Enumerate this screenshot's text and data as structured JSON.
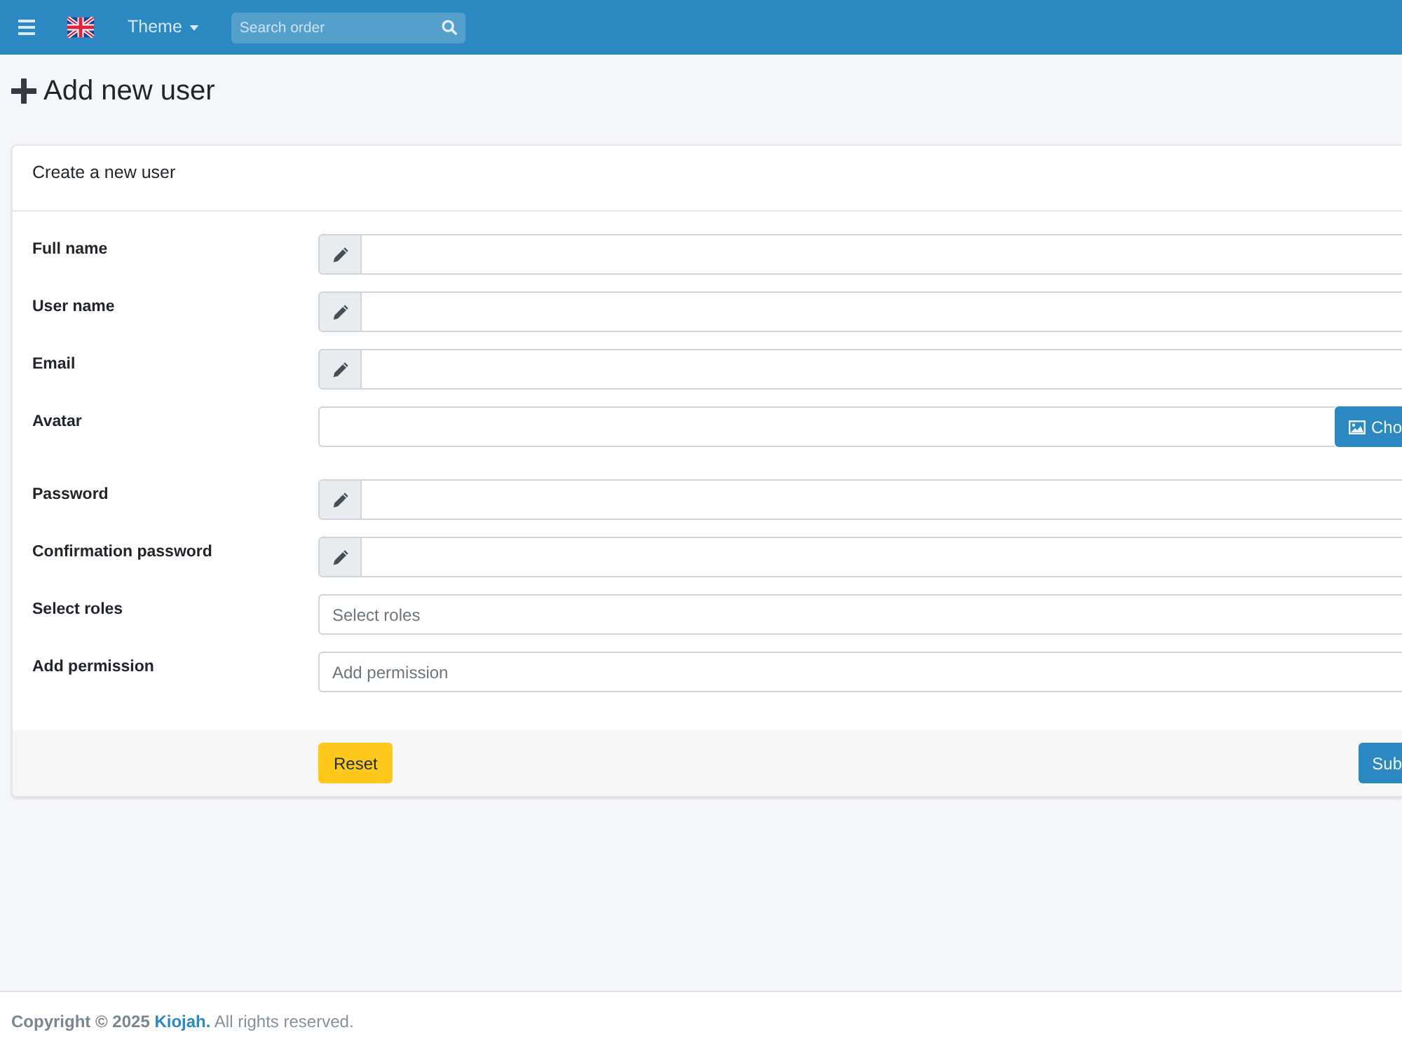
{
  "navbar": {
    "theme_menu": "Theme",
    "search": {
      "placeholder": "Search order"
    }
  },
  "page": {
    "title": "Add new user"
  },
  "card": {
    "header": "Create a new user",
    "fields": [
      {
        "label": "Full name",
        "kind": "input"
      },
      {
        "label": "User name",
        "kind": "input"
      },
      {
        "label": "Email",
        "kind": "input"
      },
      {
        "label": "Avatar",
        "kind": "file",
        "button": "Cho"
      },
      {
        "label": "Password",
        "kind": "input"
      },
      {
        "label": "Confirmation password",
        "kind": "input"
      },
      {
        "label": "Select roles",
        "kind": "select",
        "placeholder": "Select roles"
      },
      {
        "label": "Add permission",
        "kind": "select",
        "placeholder": "Add permission"
      }
    ],
    "buttons": [
      {
        "label": "Reset",
        "kind": "reset"
      },
      {
        "label": "Sub",
        "kind": "submit"
      }
    ]
  },
  "footer": {
    "copyright": "Copyright © 2025",
    "link": "Kiojah.",
    "rights": "All rights reserved."
  }
}
